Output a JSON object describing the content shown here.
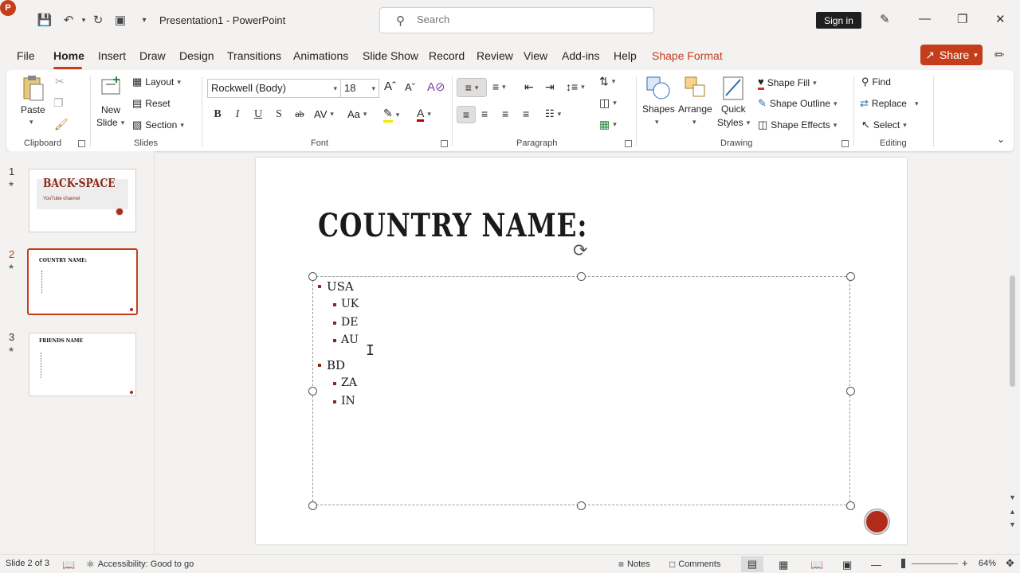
{
  "titlebar": {
    "app_logo": "P",
    "doc_title": "Presentation1  -  PowerPoint",
    "search_placeholder": "Search",
    "signin_label": "Sign in",
    "qat_icons": [
      "save-icon",
      "undo-icon",
      "redo-icon",
      "present-icon",
      "customize-icon"
    ],
    "window_icons": [
      "pen-icon",
      "minimize-icon",
      "restore-icon",
      "close-icon"
    ]
  },
  "tabs": {
    "items": [
      "File",
      "Home",
      "Insert",
      "Draw",
      "Design",
      "Transitions",
      "Animations",
      "Slide Show",
      "Record",
      "Review",
      "View",
      "Add-ins",
      "Help",
      "Shape Format"
    ],
    "active": "Home",
    "share_label": "Share"
  },
  "ribbon": {
    "clipboard": {
      "label": "Clipboard",
      "paste": "Paste"
    },
    "slides": {
      "label": "Slides",
      "new_slide_1": "New",
      "new_slide_2": "Slide",
      "layout": "Layout",
      "reset": "Reset",
      "section": "Section"
    },
    "font": {
      "label": "Font",
      "font_name": "Rockwell (Body)",
      "font_size": "18",
      "bold": "B",
      "italic": "I",
      "underline": "U",
      "shadow": "S",
      "strike": "ab"
    },
    "paragraph": {
      "label": "Paragraph"
    },
    "drawing": {
      "label": "Drawing",
      "shapes": "Shapes",
      "arrange": "Arrange",
      "quick_styles_1": "Quick",
      "quick_styles_2": "Styles",
      "shape_fill": "Shape Fill",
      "shape_outline": "Shape Outline",
      "shape_effects": "Shape Effects"
    },
    "editing": {
      "label": "Editing",
      "find": "Find",
      "replace": "Replace",
      "select": "Select"
    },
    "accent": "#c43e1c"
  },
  "thumbnails": [
    {
      "num": "1",
      "title": "BACK-SPACE",
      "subtitle": "YouTube channel"
    },
    {
      "num": "2",
      "title": "COUNTRY NAME:",
      "active": true
    },
    {
      "num": "3",
      "title": "FRIENDS NAME"
    }
  ],
  "slide": {
    "title": "COUNTRY NAME:",
    "bullets": [
      {
        "text": "USA",
        "level": 1
      },
      {
        "text": "UK",
        "level": 2
      },
      {
        "text": "DE",
        "level": 2
      },
      {
        "text": "AU",
        "level": 2
      },
      {
        "text": "BD",
        "level": 1
      },
      {
        "text": "ZA",
        "level": 2
      },
      {
        "text": "IN",
        "level": 2
      }
    ]
  },
  "statusbar": {
    "slide_counter": "Slide 2 of 3",
    "accessibility": "Accessibility: Good to go",
    "notes": "Notes",
    "comments": "Comments",
    "zoom": "64%"
  }
}
